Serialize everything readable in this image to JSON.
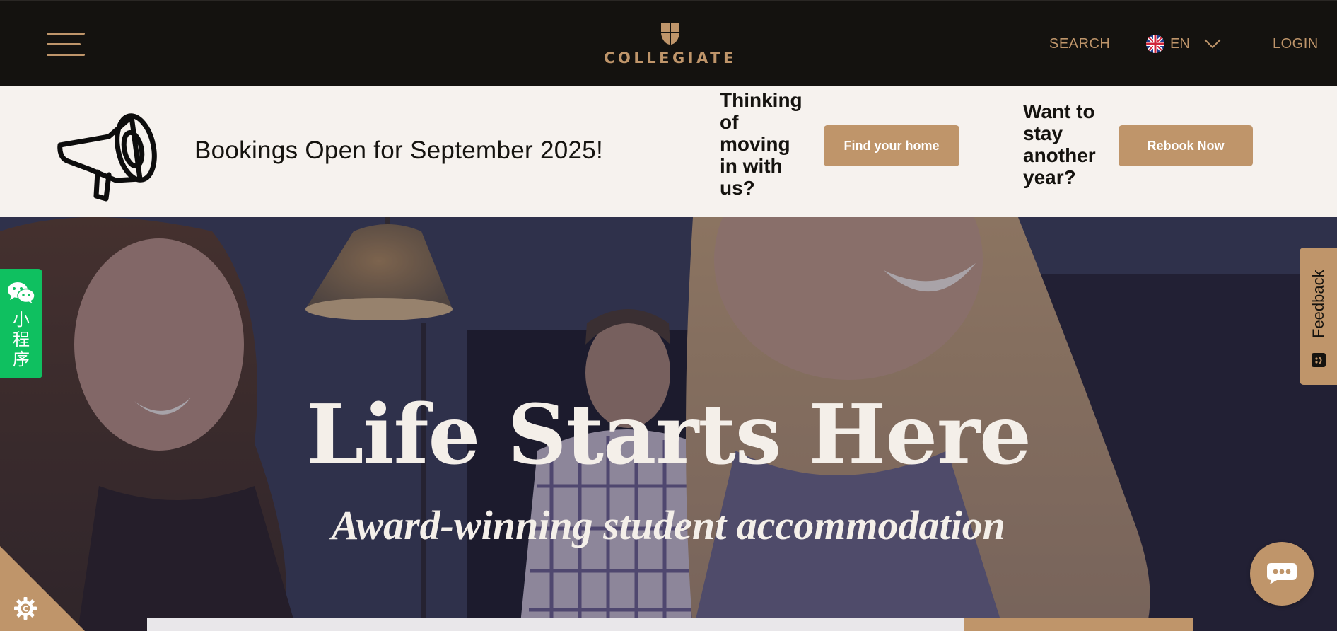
{
  "colors": {
    "accent": "#bf956a",
    "header_bg": "#14120f",
    "band_bg": "#f6f2ee",
    "wechat_green": "#0fc060",
    "hero_text": "#f4efe9"
  },
  "header": {
    "menu_icon": "hamburger-icon",
    "logo_text": "COLLEGIATE",
    "logo_icon": "shield-icon",
    "search_label": "SEARCH",
    "language": {
      "flag_icon": "uk-flag-icon",
      "selected": "EN",
      "chevron_icon": "chevron-down-icon"
    },
    "login_label": "LOGIN"
  },
  "announcement": {
    "icon": "megaphone-icon",
    "text": "Bookings Open for September 2025!",
    "cta1": {
      "question": "Thinking of moving in with us?",
      "button_label": "Find your home"
    },
    "cta2": {
      "question": "Want to stay another year?",
      "button_label": "Rebook Now"
    }
  },
  "hero": {
    "title": "Life Starts Here",
    "subtitle": "Award-winning student accommodation"
  },
  "widgets": {
    "wechat": {
      "icon": "wechat-icon",
      "label": "小程序"
    },
    "feedback": {
      "label": "Feedback",
      "icon": "feedback-smile-icon"
    },
    "cookie_icon": "cookie-settings-icon",
    "chat_icon": "chat-bubble-icon"
  }
}
